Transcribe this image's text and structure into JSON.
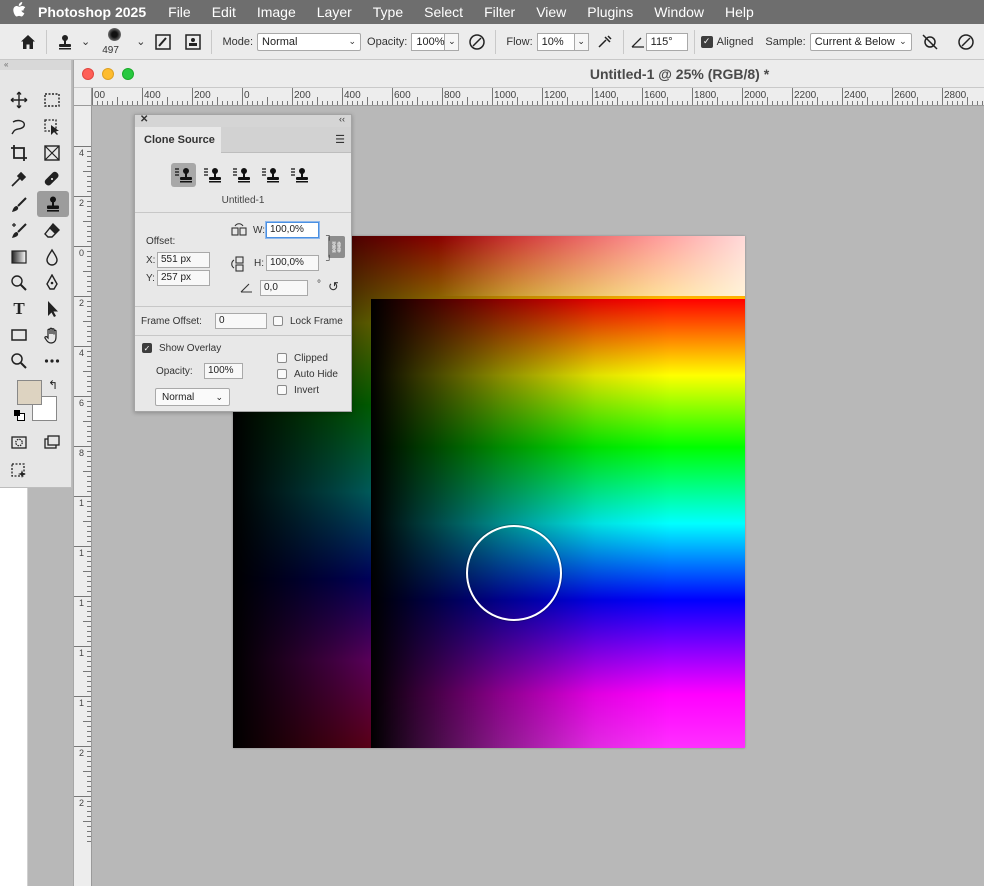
{
  "menubar": {
    "apple": "",
    "app_name": "Photoshop 2025",
    "items": [
      "File",
      "Edit",
      "Image",
      "Layer",
      "Type",
      "Select",
      "Filter",
      "View",
      "Plugins",
      "Window",
      "Help"
    ]
  },
  "options_bar": {
    "brush_size": "497",
    "mode_label": "Mode:",
    "mode_value": "Normal",
    "opacity_label": "Opacity:",
    "opacity_value": "100%",
    "flow_label": "Flow:",
    "flow_value": "10%",
    "angle_value": "115°",
    "aligned_label": "Aligned",
    "sample_label": "Sample:",
    "sample_value": "Current & Below"
  },
  "toolbar": {
    "header": "«",
    "foreground_color": "#ddd3c1",
    "background_color": "#ffffff"
  },
  "document": {
    "title": "Untitled-1 @ 25% (RGB/8) *",
    "h_ruler_labels": [
      "00",
      "400",
      "200",
      "0",
      "200",
      "400",
      "600",
      "800",
      "1000",
      "1200",
      "1400",
      "1600",
      "1800",
      "2000",
      "2200",
      "2400",
      "2600",
      "2800"
    ],
    "v_ruler_labels": [
      "4",
      "2",
      "0",
      "2",
      "4",
      "6",
      "8",
      "1",
      "1",
      "1",
      "1",
      "1",
      "2",
      "2"
    ]
  },
  "clone_source": {
    "tab_label": "Clone Source",
    "source_name": "Untitled-1",
    "offset_label": "Offset:",
    "x_label": "X:",
    "x_value": "551 px",
    "y_label": "Y:",
    "y_value": "257 px",
    "w_label": "W:",
    "w_value": "100,0%",
    "h_label": "H:",
    "h_value": "100,0%",
    "angle_value": "0,0",
    "degree": "°",
    "frame_offset_label": "Frame Offset:",
    "frame_offset_value": "0",
    "lock_frame_label": "Lock Frame",
    "show_overlay_label": "Show Overlay",
    "opacity_label": "Opacity:",
    "opacity_value": "100%",
    "blend_mode": "Normal",
    "clipped_label": "Clipped",
    "auto_hide_label": "Auto Hide",
    "invert_label": "Invert"
  }
}
